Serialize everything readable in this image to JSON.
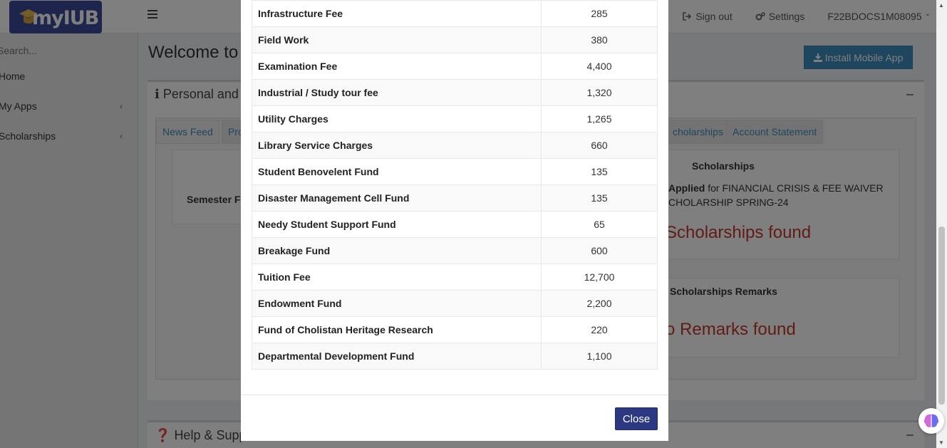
{
  "app": {
    "logo_text": "myIUB"
  },
  "header": {
    "sign_out_label": "Sign out",
    "settings_label": "Settings",
    "user_id": "F22BDOCS1M08095"
  },
  "sidebar": {
    "search_placeholder": "Search...",
    "items": [
      {
        "label": "Home"
      },
      {
        "label": "My Apps"
      },
      {
        "label": "Scholarships"
      }
    ]
  },
  "main": {
    "welcome_title": "Welcome to",
    "install_button": "Install Mobile App",
    "personal_box_title": "Personal and",
    "tabs": [
      {
        "label": "News Feed"
      },
      {
        "label": "Pro"
      },
      {
        "label": "cholarships"
      },
      {
        "label": "Account Statement"
      }
    ],
    "semester_label": "Semester Fe",
    "scholarships": {
      "title": "Scholarships",
      "applied_bold": "Applied",
      "applied_rest": " for FINANCIAL CRISIS & FEE WAIVER",
      "applied_line2": "CHOLARSHIP SPRING-24",
      "found_text": "Scholarships found"
    },
    "remarks": {
      "title": "Scholarships Remarks",
      "found_text": "o Remarks found"
    },
    "help_box_title": "Help & Supp"
  },
  "modal": {
    "fees": [
      {
        "name": "Infrastructure Fee",
        "amount": "285"
      },
      {
        "name": "Field Work",
        "amount": "380"
      },
      {
        "name": "Examination Fee",
        "amount": "4,400"
      },
      {
        "name": "Industrial / Study tour fee",
        "amount": "1,320"
      },
      {
        "name": "Utility Charges",
        "amount": "1,265"
      },
      {
        "name": "Library Service Charges",
        "amount": "660"
      },
      {
        "name": "Student Benovelent Fund",
        "amount": "135"
      },
      {
        "name": "Disaster Management Cell Fund",
        "amount": "135"
      },
      {
        "name": "Needy Student Support Fund",
        "amount": "65"
      },
      {
        "name": "Breakage Fund",
        "amount": "600"
      },
      {
        "name": "Tuition Fee",
        "amount": "12,700"
      },
      {
        "name": "Endowment Fund",
        "amount": "2,200"
      },
      {
        "name": "Fund of Cholistan Heritage Research",
        "amount": "220"
      },
      {
        "name": "Departmental Development Fund",
        "amount": "1,100"
      }
    ],
    "close_label": "Close"
  },
  "colors": {
    "brand": "#3c4b98",
    "link": "#3c8dbc",
    "close_button": "#2c3882",
    "danger_text": "#c0392b"
  }
}
